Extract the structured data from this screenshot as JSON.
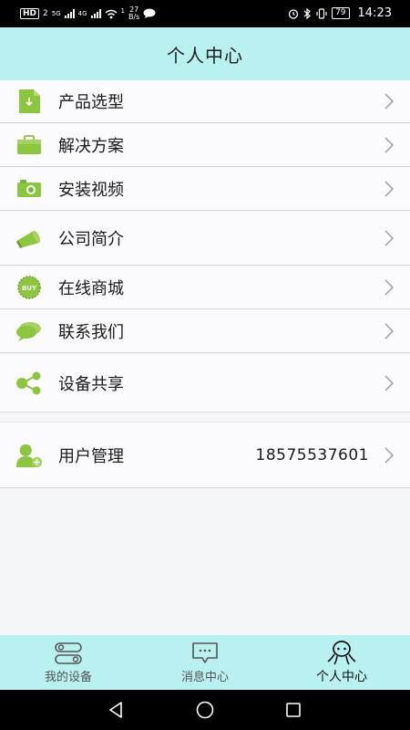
{
  "status_bar": {
    "network_badge": "HD",
    "sim_slot": "2",
    "signal_5g": "5G",
    "signal_4g": "4G",
    "wifi_level": "1",
    "speed_value": "27",
    "speed_unit": "B/s",
    "battery": "79",
    "time": "14:23"
  },
  "header": {
    "title": "个人中心"
  },
  "menu": [
    {
      "label": "产品选型",
      "icon": "document-download-icon"
    },
    {
      "label": "解决方案",
      "icon": "briefcase-icon"
    },
    {
      "label": "安装视频",
      "icon": "camera-icon"
    },
    {
      "label": "公司简介",
      "icon": "megaphone-icon"
    },
    {
      "label": "在线商城",
      "icon": "buy-badge-icon",
      "badge_text": "BUY"
    },
    {
      "label": "联系我们",
      "icon": "chat-bubbles-icon"
    },
    {
      "label": "设备共享",
      "icon": "share-icon"
    }
  ],
  "user_management": {
    "label": "用户管理",
    "value": "18575537601",
    "icon": "add-user-icon"
  },
  "tab_bar": {
    "tabs": [
      {
        "label": "我的设备",
        "icon": "devices-icon",
        "active": false
      },
      {
        "label": "消息中心",
        "icon": "message-icon",
        "active": false
      },
      {
        "label": "个人中心",
        "icon": "profile-icon",
        "active": true
      }
    ]
  },
  "nav_bar": {
    "buttons": [
      "back-icon",
      "home-icon",
      "recents-icon"
    ]
  },
  "colors": {
    "header_bg": "#b9f0f0",
    "icon_green": "#8cc63e",
    "page_bg": "#f4f5f7"
  }
}
